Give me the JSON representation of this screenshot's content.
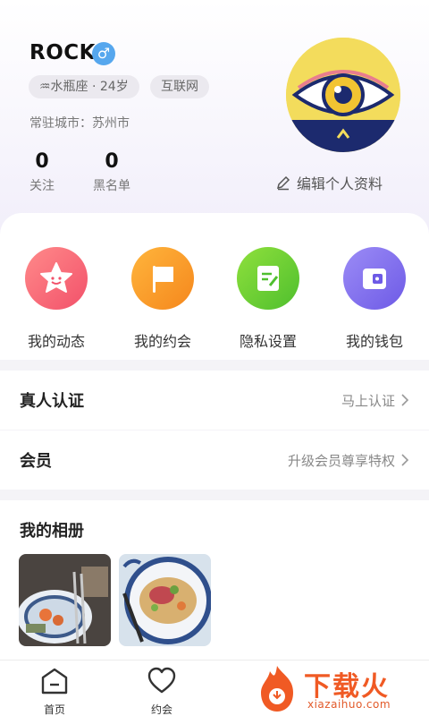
{
  "profile": {
    "name": "ROCK",
    "gender_symbol": "♂",
    "tags": [
      "♒水瓶座 · 24岁",
      "互联网"
    ],
    "city": "常驻城市：苏州市",
    "stats": [
      {
        "value": "0",
        "label": "关注"
      },
      {
        "value": "0",
        "label": "黑名单"
      }
    ],
    "edit_label": "编辑个人资料"
  },
  "features": [
    {
      "label": "我的动态",
      "icon": "star-face-icon"
    },
    {
      "label": "我的约会",
      "icon": "flag-icon"
    },
    {
      "label": "隐私设置",
      "icon": "document-edit-icon"
    },
    {
      "label": "我的钱包",
      "icon": "wallet-icon"
    }
  ],
  "rows": [
    {
      "title": "真人认证",
      "action": "马上认证"
    },
    {
      "title": "会员",
      "action": "升级会员尊享特权"
    }
  ],
  "album": {
    "title": "我的相册"
  },
  "tabs": [
    {
      "label": "首页",
      "icon": "home-icon"
    },
    {
      "label": "约会",
      "icon": "heart-icon"
    }
  ],
  "watermark": {
    "text": "下载火",
    "sub": "xiazaihuo.com"
  },
  "colors": {
    "accent_blue": "#56a7ee",
    "watermark": "#f05a24"
  }
}
